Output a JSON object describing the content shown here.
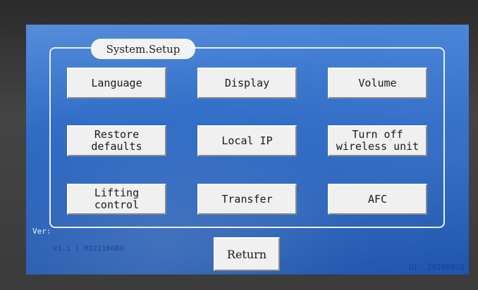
{
  "panel": {
    "title": "System.Setup"
  },
  "buttons": [
    {
      "label": "Language"
    },
    {
      "label": "Display"
    },
    {
      "label": "Volume"
    },
    {
      "label": "Restore\ndefaults"
    },
    {
      "label": "Local IP"
    },
    {
      "label": "Turn off\nwireless unit"
    },
    {
      "label": "Lifting\ncontrol"
    },
    {
      "label": "Transfer"
    },
    {
      "label": "AFC"
    }
  ],
  "footer": {
    "return_label": "Return",
    "ver_label": "Ver:",
    "ver_value": "V1.1 | M1211BOBO",
    "ui_version": "UI: 20200910"
  },
  "colors": {
    "screen_top": "#4b86d8",
    "screen_bottom": "#1f56ad",
    "button_face": "#f0f0f0"
  }
}
